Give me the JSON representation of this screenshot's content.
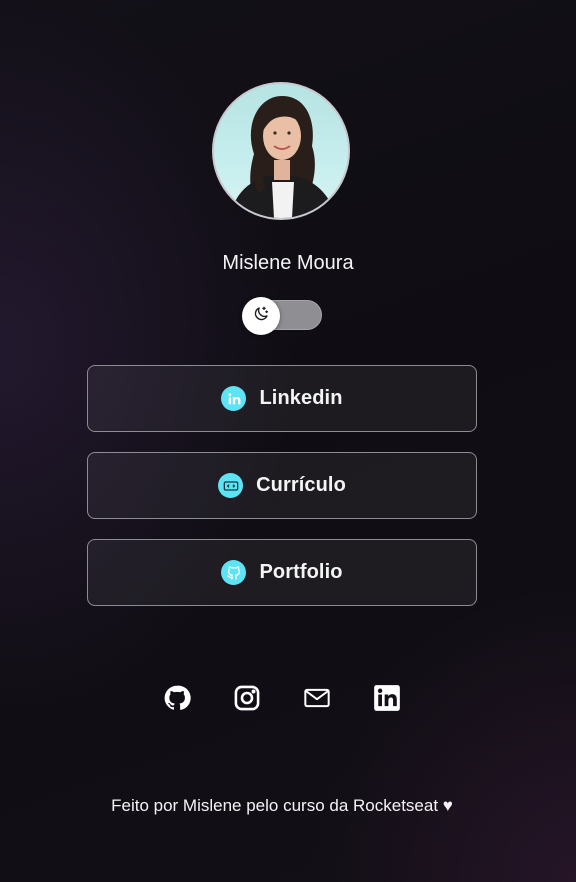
{
  "profile": {
    "name": "Mislene Moura",
    "avatar_icon": "profile-photo"
  },
  "theme_toggle": {
    "icon": "moon-icon",
    "track_color": "#8e8e93",
    "knob_color": "#ffffff"
  },
  "links": [
    {
      "label": "Linkedin",
      "icon": "linkedin-icon"
    },
    {
      "label": "Currículo",
      "icon": "resume-icon"
    },
    {
      "label": "Portfolio",
      "icon": "github-icon"
    }
  ],
  "accent_color": "#5ee3f5",
  "social": [
    {
      "icon": "github-icon"
    },
    {
      "icon": "instagram-icon"
    },
    {
      "icon": "mail-icon"
    },
    {
      "icon": "linkedin-icon"
    }
  ],
  "footer": {
    "text": "Feito por Mislene pelo curso da Rocketseat ♥"
  }
}
